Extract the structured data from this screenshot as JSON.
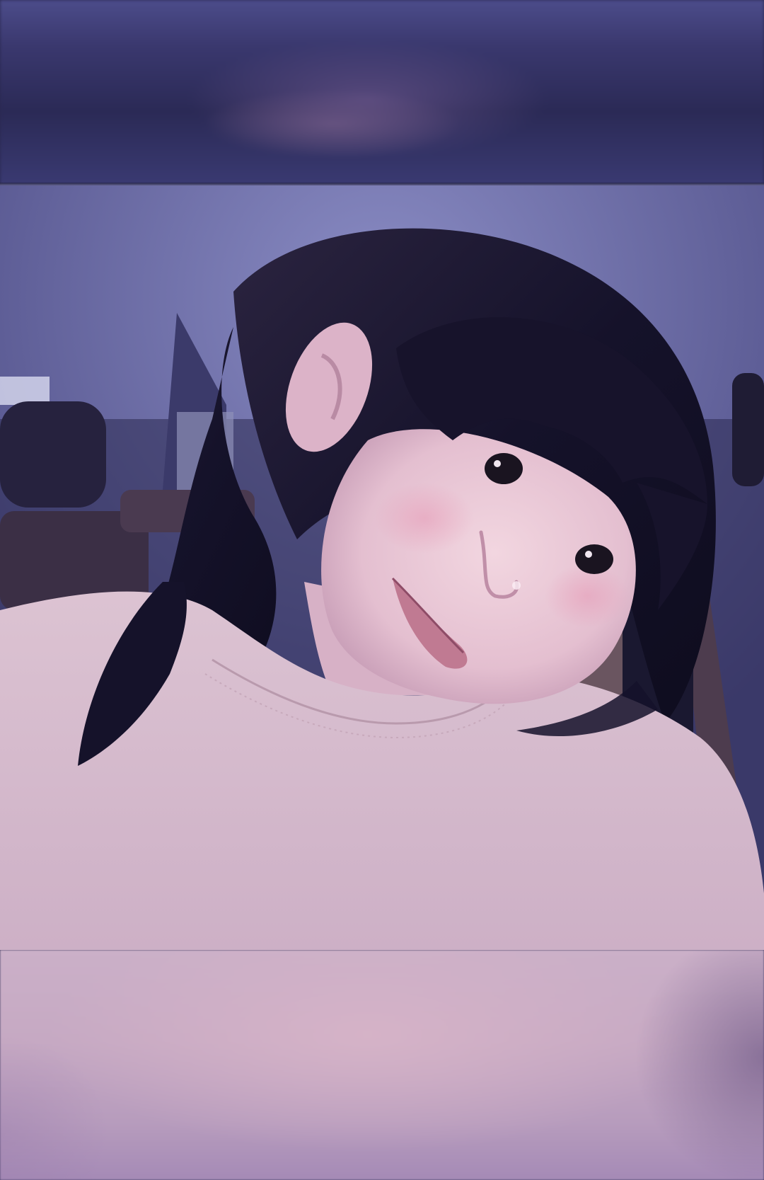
{
  "scene": {
    "kind": "photo-collage",
    "subject": "selfie",
    "palette": {
      "background": "#2a2850",
      "top_band": "#3a386e",
      "ceiling": "#7d7eb6",
      "hair": "#1a1630",
      "skin": "#e8c4d2",
      "lips": "#c07a92",
      "shirt": "#d9bfcf",
      "seat": "#2c2746",
      "bottom_band": "#c6a9c3"
    }
  }
}
